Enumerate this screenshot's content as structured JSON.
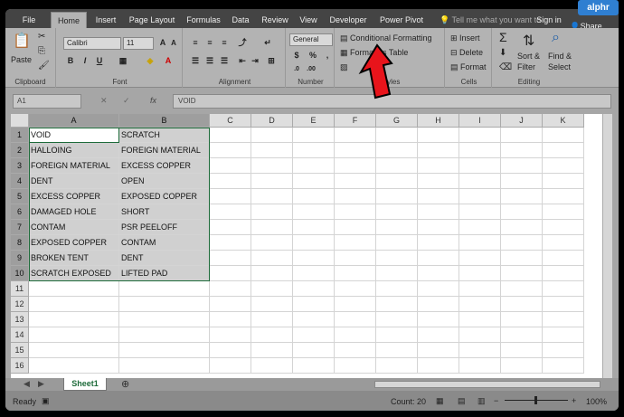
{
  "brand": "alphr",
  "tabs": [
    "File",
    "Home",
    "Insert",
    "Page Layout",
    "Formulas",
    "Data",
    "Review",
    "View",
    "Developer",
    "Power Pivot"
  ],
  "tell_me": "Tell me what you want to",
  "sign_in": "Sign in",
  "share": "Share",
  "clipboard": {
    "paste": "Paste",
    "label": "Clipboard"
  },
  "font": {
    "name": "Calibri",
    "size": "11",
    "label": "Font"
  },
  "alignment": {
    "label": "Alignment"
  },
  "number": {
    "format": "General",
    "label": "Number"
  },
  "styles": {
    "conditional": "Conditional Formatting",
    "format_table": "Format as Table",
    "label": "Styles"
  },
  "cells": {
    "insert": "Insert",
    "delete": "Delete",
    "format": "Format",
    "label": "Cells"
  },
  "editing": {
    "sort": "Sort &",
    "filter": "Filter",
    "find": "Find &",
    "select": "Select",
    "label": "Editing"
  },
  "name_box": "A1",
  "formula": "VOID",
  "columns": [
    "A",
    "B",
    "C",
    "D",
    "E",
    "F",
    "G",
    "H",
    "I",
    "J",
    "K"
  ],
  "rows": [
    "1",
    "2",
    "3",
    "4",
    "5",
    "6",
    "7",
    "8",
    "9",
    "10",
    "11",
    "12",
    "13",
    "14",
    "15",
    "16"
  ],
  "col_a": [
    "VOID",
    "HALLOING",
    "FOREIGN MATERIAL",
    "DENT",
    "EXCESS COPPER",
    "DAMAGED HOLE",
    "CONTAM",
    "EXPOSED COPPER",
    "BROKEN TENT",
    "SCRATCH EXPOSED"
  ],
  "col_b": [
    "SCRATCH",
    "FOREIGN MATERIAL",
    "EXCESS COPPER",
    "OPEN",
    "EXPOSED COPPER",
    "SHORT",
    "PSR PEELOFF",
    "CONTAM",
    "DENT",
    "LIFTED PAD"
  ],
  "sheet_name": "Sheet1",
  "status_ready": "Ready",
  "status_count": "Count: 20",
  "zoom": "100%",
  "colors": {
    "excel_green": "#1e6b3a",
    "arrow": "#e8141b",
    "logo": "#2f7fd1"
  }
}
